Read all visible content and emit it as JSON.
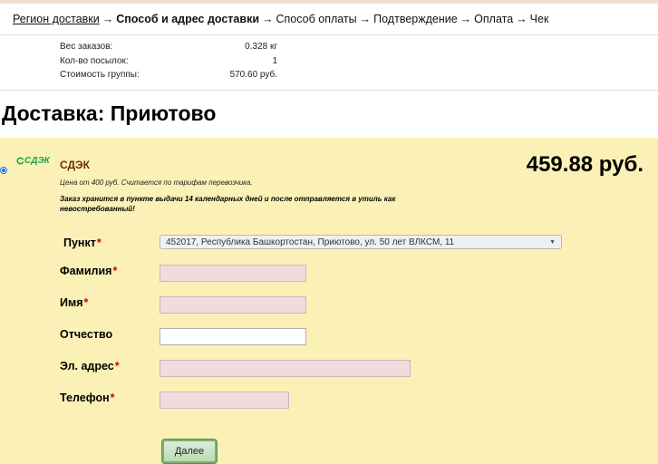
{
  "breadcrumb": {
    "step1": "Регион доставки",
    "step2": "Способ и адрес доставки",
    "step3": "Способ оплаты",
    "step4": "Подтверждение",
    "step5": "Оплата",
    "step6": "Чек",
    "separator": "→"
  },
  "summary": [
    {
      "label": "Вес заказов:",
      "value": "0.328 кг"
    },
    {
      "label": "Кол-во посылок:",
      "value": "1"
    },
    {
      "label": "Стоимость группы:",
      "value": "570.60 руб."
    }
  ],
  "page_title": "Доставка: Приютово",
  "option": {
    "selected": true,
    "logo_text": "СДЭК",
    "carrier": "СДЭК",
    "price": "459.88 руб.",
    "note_price": "Цена от 400 руб. Считается по тарифам перевозчика.",
    "note_storage": "Заказ хранится в пункте выдачи 14 календарных дней и после отправляется в утиль как невостребованный!"
  },
  "form": {
    "point_label": "Пункт",
    "point_value": "452017, Республика Башкортостан, Приютово, ул. 50 лет ВЛКСМ, 11",
    "lastname_label": "Фамилия",
    "firstname_label": "Имя",
    "middlename_label": "Отчество",
    "email_label": "Эл. адрес",
    "phone_label": "Телефон",
    "required_mark": "*",
    "lastname_value": "",
    "firstname_value": "",
    "middlename_value": "",
    "email_value": "",
    "phone_value": "",
    "submit_label": "Далее"
  },
  "colors": {
    "panel_bg": "#fbf1b6",
    "required_field_bg": "#f0dcdc",
    "required_mark": "#d40000",
    "carrier_name": "#6b2d00",
    "logo": "#1aa64a",
    "button": "#b9d8b0"
  }
}
